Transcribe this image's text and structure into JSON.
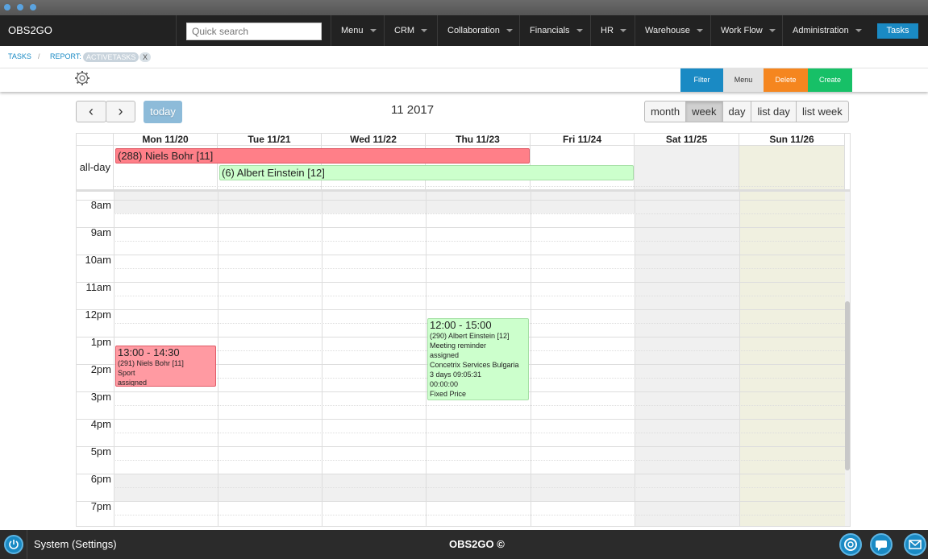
{
  "app": {
    "brand": "OBS2GO"
  },
  "nav": {
    "search_placeholder": "Quick search",
    "items": [
      "Menu",
      "CRM",
      "Collaboration",
      "Financials",
      "HR",
      "Warehouse",
      "Work Flow",
      "Administration"
    ],
    "tasks_label": "Tasks"
  },
  "breadcrumb": {
    "tasks": "TASKS",
    "separator": "/",
    "report": "REPORT:",
    "tag": "ACTIVETASKS",
    "tag_close": "X"
  },
  "toolbar": {
    "filter": "Filter",
    "menu": "Menu",
    "delete": "Delete",
    "create": "Create"
  },
  "calendar": {
    "prev": "‹",
    "next": "›",
    "today": "today",
    "title": "11 2017",
    "views": [
      "month",
      "week",
      "day",
      "list day",
      "list week"
    ],
    "active_view": "week",
    "days": [
      "Mon 11/20",
      "Tue 11/21",
      "Wed 11/22",
      "Thu 11/23",
      "Fri 11/24",
      "Sat 11/25",
      "Sun 11/26"
    ],
    "allday_label": "all-day",
    "times": [
      "8am",
      "9am",
      "10am",
      "11am",
      "12pm",
      "1pm",
      "2pm",
      "3pm",
      "4pm",
      "5pm",
      "6pm",
      "7pm"
    ],
    "allday_events": [
      {
        "title": "(288) Niels Bohr [11]",
        "color": "#ff7f88"
      },
      {
        "title": "(6) Albert Einstein [12]",
        "color": "#ccffcc"
      }
    ],
    "events": [
      {
        "time": "13:00 - 14:30",
        "lines": [
          "(291) Niels Bohr [11]",
          "Sport",
          "assigned"
        ],
        "color": "#ff9aa2"
      },
      {
        "time": "12:00 - 15:00",
        "lines": [
          "(290) Albert Einstein [12]",
          "Meeting reminder",
          "assigned",
          "Concetrix Services Bulgaria",
          "3 days 09:05:31",
          "00:00:00",
          "Fixed Price"
        ],
        "color": "#ccffcc"
      }
    ]
  },
  "footer": {
    "system": "System (Settings)",
    "brand": "OBS2GO ©"
  },
  "colors": {
    "accent": "#1a8ac4",
    "delete": "#f5861f",
    "create": "#17c067",
    "menu": "#e3e3e3"
  }
}
